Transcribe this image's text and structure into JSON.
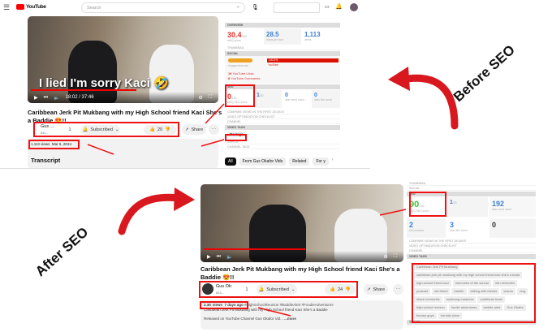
{
  "before": {
    "header": {
      "logo": "YouTube",
      "search_placeholder": "Search"
    },
    "video": {
      "subtitle": "I lied I'm sorry Kaci 🤣",
      "time": "18:02 / 37:46"
    },
    "title": "Caribbean Jerk Pit Mukbang with my High School friend Kaci She's a Baddie 😍!!",
    "channel": {
      "name": "Gus ...",
      "subs": "841...",
      "members": "1",
      "subscribed": "Subscribed",
      "likes": "20",
      "share": "Share"
    },
    "views": "1,113 views  Mar 6, 2024",
    "transcript": "Transcript",
    "panel": {
      "overview": "OVERVIEW",
      "score": "30.4",
      "score_max": "/100",
      "score_label": "vidIQ score",
      "views_per_hour": "28.5",
      "vph_label": "views per hour",
      "views": "1,113",
      "views_label": "views",
      "thumbnail": "THUMBNAIL",
      "social": "SOCIAL",
      "engagement_label": "engagement rate",
      "youtube_pct": "100.0%",
      "youtube": "YouTube",
      "likes": "19",
      "likes_label": "YouTube Likes",
      "comments": "8",
      "comments_label": "YouTube Comments",
      "seo": "SEO",
      "seo_score": "0",
      "seo_max": "/100",
      "seo_label": "vidIQ SEO score",
      "rank": "1",
      "rank_max": "/30",
      "wc": "0",
      "wc_label": "desc word count",
      "lc": "0",
      "lc_label": "desc link count",
      "rows": [
        "COMPARE VIEWS IN THE FIRST 28 DAYS",
        "VIDEO OPTIMIZATION CHECKLIST",
        "CHANNEL"
      ],
      "video_tags": "VIDEO TAGS",
      "no_tags": "No tags",
      "topics": "TOPICS",
      "channel_tags": "CHANNEL TAGS"
    },
    "chips": [
      "All",
      "From Gus Okafor Vids",
      "Related",
      "For y"
    ]
  },
  "after": {
    "title": "Caribbean Jerk Pit Mukbang with my High School friend Kaci She's a Baddie 😍!!",
    "channel": {
      "name": "Gus Ok:",
      "subs": "843...",
      "members": "1",
      "subscribed": "Subscribed",
      "likes": "24",
      "share": "Share"
    },
    "views": "2.3K views  7 days ago",
    "hashtags": "#HighSchoolReunion #BaddieAlert #FoodieAdventures",
    "desc1": "Caribbean Jerk Pit Mukbang with my High School friend Kaci She's a Baddie",
    "desc2": "Released on YouTube Channel Gus Okafor Vid...",
    "more": "...more",
    "panel": {
      "thumbnail": "THUMBNAIL",
      "social": "SOCIAL",
      "seo": "SEO",
      "seo_score": "90",
      "seo_max": "/100",
      "seo_label": "vidIQ SEO score",
      "rank": "1",
      "rank_max": "/30",
      "wc": "192",
      "wc_label": "desc word count",
      "end": "2",
      "end_label": "end screens",
      "lc": "3",
      "lc_label": "desc link count",
      "cards": "0",
      "rows": [
        "COMPARE VIEWS IN THE FIRST 28 DAYS",
        "VIDEO OPTIMIZATION CHECKLIST",
        "CHANNEL"
      ],
      "video_tags": "VIDEO TAGS",
      "topics": "TOPICS",
      "tags": [
        "Caribbean Jerk Pit Mukbang",
        "caribbean jerk pit mukbang with my high school friend kaci she's a badd",
        "high school friend kaci",
        "memories of the school",
        "old memories",
        "podcast",
        "old friend",
        "baddie",
        "talking with friends",
        "videos",
        "vlog",
        "share memories",
        "mukbang madness",
        "caribbean feast",
        "high school reunion",
        "foodie adventures",
        "baddie alert",
        "Gus Okafor",
        "funney guys",
        "fun talk show"
      ]
    }
  },
  "labels": {
    "before": "Before SEO",
    "after": "After SEO"
  },
  "colors": {
    "highlight": "#e11111",
    "brand": "#ff0000",
    "score_red": "#e0302a",
    "score_green": "#3ec43e",
    "accent": "#3b7fd0"
  }
}
